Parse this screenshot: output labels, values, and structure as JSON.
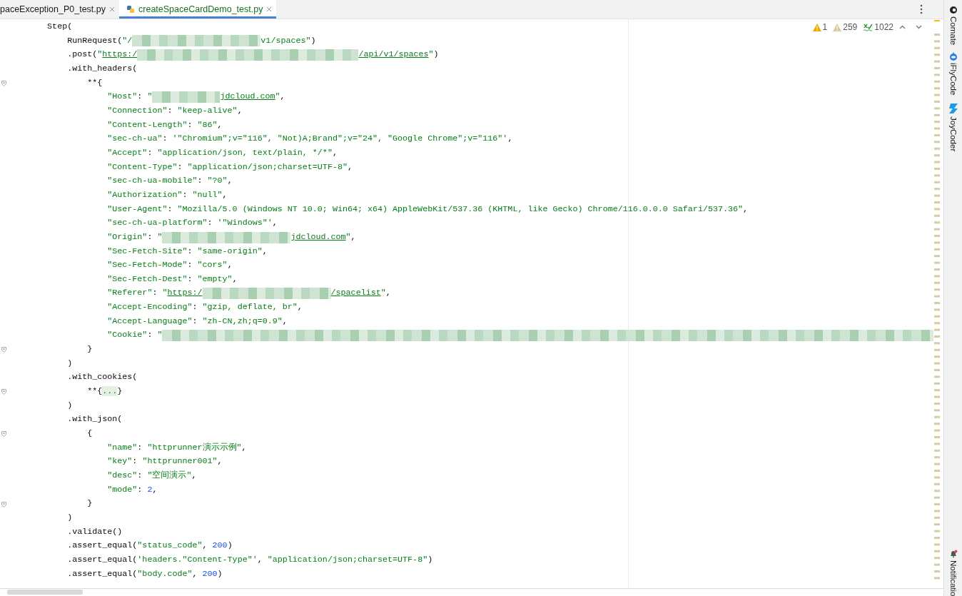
{
  "tabs": [
    {
      "label": "paceException_P0_test.py",
      "selected": false
    },
    {
      "label": "createSpaceCardDemo_test.py",
      "selected": true
    }
  ],
  "inspections": [
    {
      "kind": "warning",
      "count": "1"
    },
    {
      "kind": "weak_warning",
      "count": "259"
    },
    {
      "kind": "typo",
      "count": "1022"
    }
  ],
  "tool_windows": [
    {
      "kind": "comate",
      "label": "Comate"
    },
    {
      "kind": "iflycode",
      "label": "iFlyCode"
    },
    {
      "kind": "joycoder",
      "label": "JoyCoder"
    }
  ],
  "notifications": {
    "label": "Notificatio",
    "unread": true
  },
  "code_lines": [
    {
      "fold": false,
      "parts": [
        {
          "kind": "code",
          "text": "        Step("
        }
      ]
    },
    {
      "fold": false,
      "parts": [
        {
          "kind": "code",
          "text": "            RunRequest("
        },
        {
          "kind": "str",
          "text": "\"/"
        },
        {
          "kind": "redacted_medium"
        },
        {
          "kind": "str",
          "text": "v1/spaces\""
        },
        {
          "kind": "code",
          "text": ")"
        }
      ]
    },
    {
      "fold": false,
      "parts": [
        {
          "kind": "code",
          "text": "            .post("
        },
        {
          "kind": "str",
          "text": "\""
        },
        {
          "kind": "url",
          "text": "https:/"
        },
        {
          "kind": "redacted_long"
        },
        {
          "kind": "url",
          "text": "/api/v1/spaces"
        },
        {
          "kind": "str",
          "text": "\""
        },
        {
          "kind": "code",
          "text": ")"
        }
      ]
    },
    {
      "fold": false,
      "parts": [
        {
          "kind": "code",
          "text": "            .with_headers("
        }
      ]
    },
    {
      "fold": true,
      "parts": [
        {
          "kind": "code",
          "text": "                **{"
        }
      ]
    },
    {
      "fold": false,
      "parts": [
        {
          "kind": "str",
          "text": "                    \"Host\""
        },
        {
          "kind": "code",
          "text": ": "
        },
        {
          "kind": "str",
          "text": "\""
        },
        {
          "kind": "redacted_short"
        },
        {
          "kind": "url",
          "text": "jdcloud.com"
        },
        {
          "kind": "str",
          "text": "\""
        },
        {
          "kind": "code",
          "text": ","
        }
      ]
    },
    {
      "fold": false,
      "parts": [
        {
          "kind": "str",
          "text": "                    \"Connection\""
        },
        {
          "kind": "code",
          "text": ": "
        },
        {
          "kind": "str",
          "text": "\"keep-alive\""
        },
        {
          "kind": "code",
          "text": ","
        }
      ]
    },
    {
      "fold": false,
      "parts": [
        {
          "kind": "str",
          "text": "                    \"Content-Length\""
        },
        {
          "kind": "code",
          "text": ": "
        },
        {
          "kind": "str",
          "text": "\"86\""
        },
        {
          "kind": "code",
          "text": ","
        }
      ]
    },
    {
      "fold": false,
      "parts": [
        {
          "kind": "str",
          "text": "                    \"sec-ch-ua\""
        },
        {
          "kind": "code",
          "text": ": "
        },
        {
          "kind": "str",
          "text": "'\"Chromium\";v=\"116\", \"Not)A;Brand\";v=\"24\", \"Google Chrome\";v=\"116\"'"
        },
        {
          "kind": "code",
          "text": ","
        }
      ]
    },
    {
      "fold": false,
      "parts": [
        {
          "kind": "str",
          "text": "                    \"Accept\""
        },
        {
          "kind": "code",
          "text": ": "
        },
        {
          "kind": "str",
          "text": "\"application/json, text/plain, */*\""
        },
        {
          "kind": "code",
          "text": ","
        }
      ]
    },
    {
      "fold": false,
      "parts": [
        {
          "kind": "str",
          "text": "                    \"Content-Type\""
        },
        {
          "kind": "code",
          "text": ": "
        },
        {
          "kind": "str",
          "text": "\"application/json;charset=UTF-8\""
        },
        {
          "kind": "code",
          "text": ","
        }
      ]
    },
    {
      "fold": false,
      "parts": [
        {
          "kind": "str",
          "text": "                    \"sec-ch-ua-mobile\""
        },
        {
          "kind": "code",
          "text": ": "
        },
        {
          "kind": "str",
          "text": "\"?0\""
        },
        {
          "kind": "code",
          "text": ","
        }
      ]
    },
    {
      "fold": false,
      "parts": [
        {
          "kind": "str",
          "text": "                    \"Authorization\""
        },
        {
          "kind": "code",
          "text": ": "
        },
        {
          "kind": "str",
          "text": "\"null\""
        },
        {
          "kind": "code",
          "text": ","
        }
      ]
    },
    {
      "fold": false,
      "parts": [
        {
          "kind": "str",
          "text": "                    \"User-Agent\""
        },
        {
          "kind": "code",
          "text": ": "
        },
        {
          "kind": "str",
          "text": "\"Mozilla/5.0 (Windows NT 10.0; Win64; x64) AppleWebKit/537.36 (KHTML, like Gecko) Chrome/116.0.0.0 Safari/537.36\""
        },
        {
          "kind": "code",
          "text": ","
        }
      ]
    },
    {
      "fold": false,
      "parts": [
        {
          "kind": "str",
          "text": "                    \"sec-ch-ua-platform\""
        },
        {
          "kind": "code",
          "text": ": "
        },
        {
          "kind": "str",
          "text": "'\"Windows\"'"
        },
        {
          "kind": "code",
          "text": ","
        }
      ]
    },
    {
      "fold": false,
      "parts": [
        {
          "kind": "str",
          "text": "                    \"Origin\""
        },
        {
          "kind": "code",
          "text": ": "
        },
        {
          "kind": "str",
          "text": "\""
        },
        {
          "kind": "redacted_medium"
        },
        {
          "kind": "url",
          "text": "jdcloud.com"
        },
        {
          "kind": "str",
          "text": "\""
        },
        {
          "kind": "code",
          "text": ","
        }
      ]
    },
    {
      "fold": false,
      "parts": [
        {
          "kind": "str",
          "text": "                    \"Sec-Fetch-Site\""
        },
        {
          "kind": "code",
          "text": ": "
        },
        {
          "kind": "str",
          "text": "\"same-origin\""
        },
        {
          "kind": "code",
          "text": ","
        }
      ]
    },
    {
      "fold": false,
      "parts": [
        {
          "kind": "str",
          "text": "                    \"Sec-Fetch-Mode\""
        },
        {
          "kind": "code",
          "text": ": "
        },
        {
          "kind": "str",
          "text": "\"cors\""
        },
        {
          "kind": "code",
          "text": ","
        }
      ]
    },
    {
      "fold": false,
      "parts": [
        {
          "kind": "str",
          "text": "                    \"Sec-Fetch-Dest\""
        },
        {
          "kind": "code",
          "text": ": "
        },
        {
          "kind": "str",
          "text": "\"empty\""
        },
        {
          "kind": "code",
          "text": ","
        }
      ]
    },
    {
      "fold": false,
      "parts": [
        {
          "kind": "str",
          "text": "                    \"Referer\""
        },
        {
          "kind": "code",
          "text": ": "
        },
        {
          "kind": "str",
          "text": "\""
        },
        {
          "kind": "url",
          "text": "https:/"
        },
        {
          "kind": "redacted_medium"
        },
        {
          "kind": "url",
          "text": "/spacelist"
        },
        {
          "kind": "str",
          "text": "\""
        },
        {
          "kind": "code",
          "text": ","
        }
      ]
    },
    {
      "fold": false,
      "parts": [
        {
          "kind": "str",
          "text": "                    \"Accept-Encoding\""
        },
        {
          "kind": "code",
          "text": ": "
        },
        {
          "kind": "str",
          "text": "\"gzip, deflate, br\""
        },
        {
          "kind": "code",
          "text": ","
        }
      ]
    },
    {
      "fold": false,
      "parts": [
        {
          "kind": "str",
          "text": "                    \"Accept-Language\""
        },
        {
          "kind": "code",
          "text": ": "
        },
        {
          "kind": "str",
          "text": "\"zh-CN,zh;q=0.9\""
        },
        {
          "kind": "code",
          "text": ","
        }
      ]
    },
    {
      "fold": false,
      "parts": [
        {
          "kind": "str",
          "text": "                    \"Cookie\""
        },
        {
          "kind": "code",
          "text": ": "
        },
        {
          "kind": "str",
          "text": "\""
        },
        {
          "kind": "redacted_full"
        }
      ]
    },
    {
      "fold": true,
      "parts": [
        {
          "kind": "code",
          "text": "                }"
        }
      ]
    },
    {
      "fold": false,
      "parts": [
        {
          "kind": "code",
          "text": "            )"
        }
      ]
    },
    {
      "fold": false,
      "parts": [
        {
          "kind": "code",
          "text": "            .with_cookies("
        }
      ]
    },
    {
      "fold": true,
      "parts": [
        {
          "kind": "code",
          "text": "                **{"
        },
        {
          "kind": "folded",
          "text": "..."
        },
        {
          "kind": "code",
          "text": "}"
        }
      ]
    },
    {
      "fold": false,
      "parts": [
        {
          "kind": "code",
          "text": "            )"
        }
      ]
    },
    {
      "fold": false,
      "parts": [
        {
          "kind": "code",
          "text": "            .with_json("
        }
      ]
    },
    {
      "fold": true,
      "parts": [
        {
          "kind": "code",
          "text": "                {"
        }
      ]
    },
    {
      "fold": false,
      "parts": [
        {
          "kind": "str",
          "text": "                    \"name\""
        },
        {
          "kind": "code",
          "text": ": "
        },
        {
          "kind": "str",
          "text": "\"httprunner演示示例\""
        },
        {
          "kind": "code",
          "text": ","
        }
      ]
    },
    {
      "fold": false,
      "parts": [
        {
          "kind": "str",
          "text": "                    \"key\""
        },
        {
          "kind": "code",
          "text": ": "
        },
        {
          "kind": "str",
          "text": "\"httprunner001\""
        },
        {
          "kind": "code",
          "text": ","
        }
      ]
    },
    {
      "fold": false,
      "parts": [
        {
          "kind": "str",
          "text": "                    \"desc\""
        },
        {
          "kind": "code",
          "text": ": "
        },
        {
          "kind": "str",
          "text": "\"空间演示\""
        },
        {
          "kind": "code",
          "text": ","
        }
      ]
    },
    {
      "fold": false,
      "parts": [
        {
          "kind": "str",
          "text": "                    \"mode\""
        },
        {
          "kind": "code",
          "text": ": "
        },
        {
          "kind": "num",
          "text": "2"
        },
        {
          "kind": "code",
          "text": ","
        }
      ]
    },
    {
      "fold": true,
      "parts": [
        {
          "kind": "code",
          "text": "                }"
        }
      ]
    },
    {
      "fold": false,
      "parts": [
        {
          "kind": "code",
          "text": "            )"
        }
      ]
    },
    {
      "fold": false,
      "parts": [
        {
          "kind": "code",
          "text": "            .validate()"
        }
      ]
    },
    {
      "fold": false,
      "parts": [
        {
          "kind": "code",
          "text": "            .assert_equal("
        },
        {
          "kind": "str",
          "text": "\"status_code\""
        },
        {
          "kind": "code",
          "text": ", "
        },
        {
          "kind": "num",
          "text": "200"
        },
        {
          "kind": "code",
          "text": ")"
        }
      ]
    },
    {
      "fold": false,
      "parts": [
        {
          "kind": "code",
          "text": "            .assert_equal("
        },
        {
          "kind": "str",
          "text": "'headers.\"Content-Type\"'"
        },
        {
          "kind": "code",
          "text": ", "
        },
        {
          "kind": "str",
          "text": "\"application/json;charset=UTF-8\""
        },
        {
          "kind": "code",
          "text": ")"
        }
      ]
    },
    {
      "fold": false,
      "parts": [
        {
          "kind": "code",
          "text": "            .assert_equal("
        },
        {
          "kind": "str",
          "text": "\"body.code\""
        },
        {
          "kind": "code",
          "text": ", "
        },
        {
          "kind": "num",
          "text": "200"
        },
        {
          "kind": "code",
          "text": ")"
        }
      ]
    }
  ]
}
